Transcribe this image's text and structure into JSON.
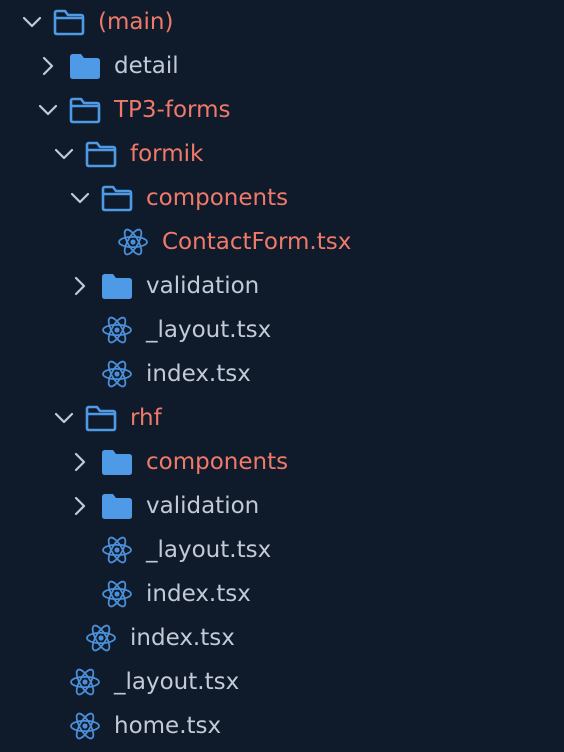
{
  "explorer": {
    "items": [
      {
        "label": "(main)",
        "kind": "folder",
        "expanded": true,
        "modified": true
      },
      {
        "label": "detail",
        "kind": "folder",
        "expanded": false,
        "modified": false
      },
      {
        "label": "TP3-forms",
        "kind": "folder",
        "expanded": true,
        "modified": true
      },
      {
        "label": "formik",
        "kind": "folder",
        "expanded": true,
        "modified": true
      },
      {
        "label": "components",
        "kind": "folder",
        "expanded": true,
        "modified": true
      },
      {
        "label": "ContactForm.tsx",
        "kind": "file",
        "modified": true
      },
      {
        "label": "validation",
        "kind": "folder",
        "expanded": false,
        "modified": false
      },
      {
        "label": "_layout.tsx",
        "kind": "file",
        "modified": false
      },
      {
        "label": "index.tsx",
        "kind": "file",
        "modified": false
      },
      {
        "label": "rhf",
        "kind": "folder",
        "expanded": true,
        "modified": true
      },
      {
        "label": "components",
        "kind": "folder",
        "expanded": false,
        "modified": true
      },
      {
        "label": "validation",
        "kind": "folder",
        "expanded": false,
        "modified": false
      },
      {
        "label": "_layout.tsx",
        "kind": "file",
        "modified": false
      },
      {
        "label": "index.tsx",
        "kind": "file",
        "modified": false
      },
      {
        "label": "index.tsx",
        "kind": "file",
        "modified": false
      },
      {
        "label": "_layout.tsx",
        "kind": "file",
        "modified": false
      },
      {
        "label": "home.tsx",
        "kind": "file",
        "modified": false
      }
    ]
  },
  "icons": {
    "folder_closed": "folder-icon",
    "folder_open": "folder-open-icon",
    "file": "react-icon",
    "expanded": "chevron-down-icon",
    "collapsed": "chevron-right-icon"
  },
  "colors": {
    "background": "#0f1a2a",
    "modified_text": "#f07a6a",
    "normal_text": "#c2cad6",
    "folder_icon": "#4e9ae6",
    "react_icon": "#4a8fd8",
    "chevron": "#c2cad6"
  }
}
